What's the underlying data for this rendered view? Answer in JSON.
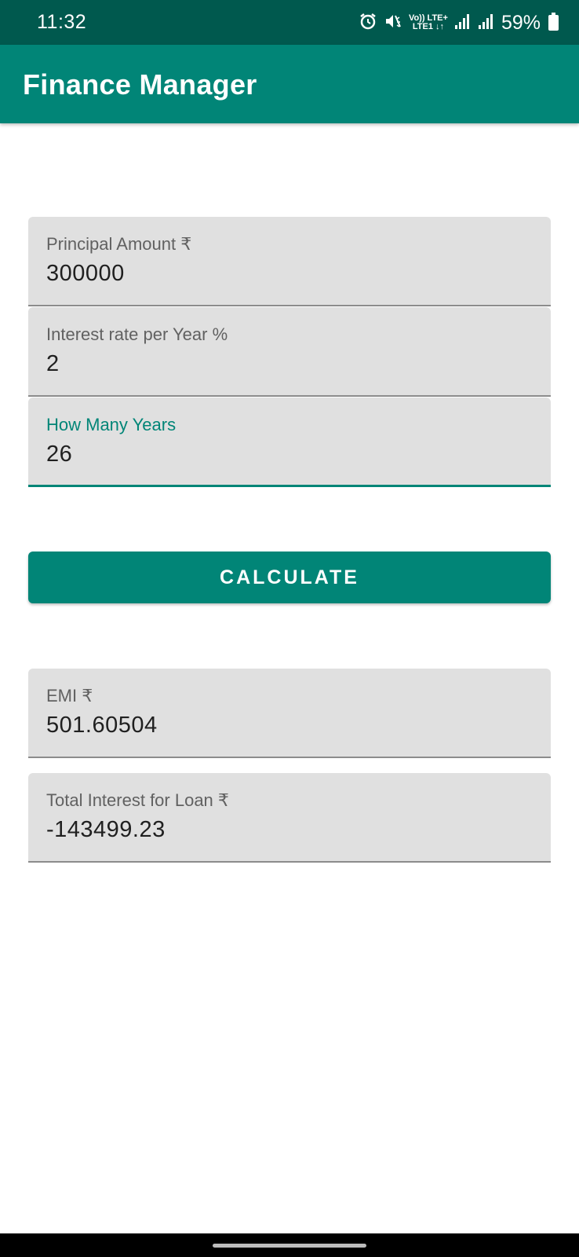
{
  "status_bar": {
    "time": "11:32",
    "volte_top": "Vo)) LTE+",
    "volte_bottom": "LTE1 ↓↑",
    "battery": "59%"
  },
  "app_bar": {
    "title": "Finance Manager"
  },
  "form": {
    "principal": {
      "label": "Principal Amount ₹",
      "value": "300000"
    },
    "interest": {
      "label": "Interest rate per Year %",
      "value": "2"
    },
    "years": {
      "label": "How Many Years",
      "value": "26"
    },
    "calculate_label": "CALCULATE"
  },
  "results": {
    "emi": {
      "label": "EMI ₹",
      "value": "501.60504"
    },
    "total_interest": {
      "label": "Total Interest for Loan ₹",
      "value": "-143499.23"
    }
  },
  "colors": {
    "status_bar": "#00594e",
    "primary": "#018577",
    "field_bg": "#e0e0e0"
  },
  "icons": [
    "alarm-icon",
    "mute-icon",
    "signal-icon",
    "battery-icon"
  ]
}
